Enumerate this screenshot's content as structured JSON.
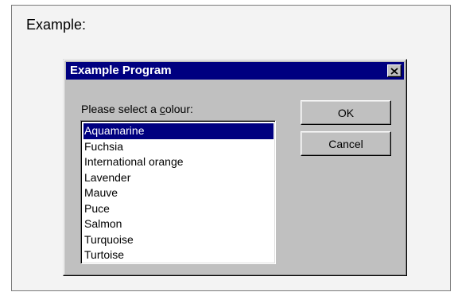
{
  "example_label": "Example:",
  "dialog": {
    "title": "Example Program",
    "prompt_before": "Please select a ",
    "prompt_accel": "c",
    "prompt_after": "olour:",
    "colours": [
      "Aquamarine",
      "Fuchsia",
      "International orange",
      "Lavender",
      "Mauve",
      "Puce",
      "Salmon",
      "Turquoise",
      "Turtoise"
    ],
    "selected_index": 0,
    "ok_label": "OK",
    "cancel_label": "Cancel"
  },
  "colors": {
    "titlebar": "#000080",
    "face": "#c0c0c0",
    "selection": "#000080"
  },
  "icons": {
    "close": "close-icon"
  }
}
